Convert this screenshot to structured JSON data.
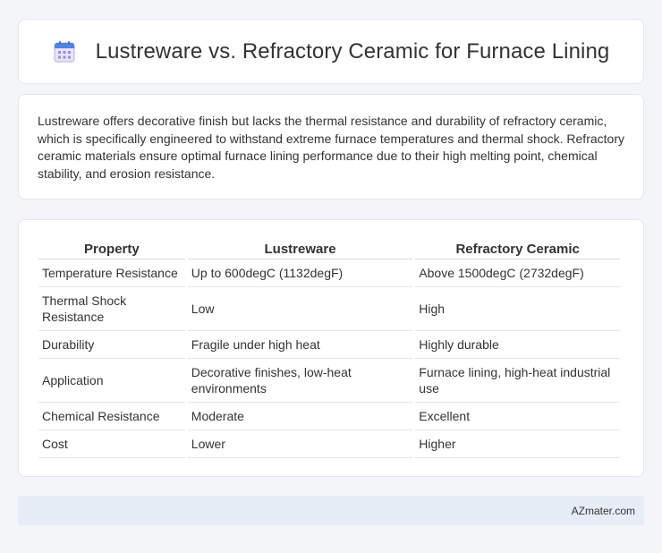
{
  "header": {
    "icon": "calendar-icon",
    "title": "Lustreware vs. Refractory Ceramic for Furnace Lining"
  },
  "summary": {
    "text": "Lustreware offers decorative finish but lacks the thermal resistance and durability of refractory ceramic, which is specifically engineered to withstand extreme furnace temperatures and thermal shock. Refractory ceramic materials ensure optimal furnace lining performance due to their high melting point, chemical stability, and erosion resistance."
  },
  "table": {
    "headers": [
      "Property",
      "Lustreware",
      "Refractory Ceramic"
    ],
    "rows": [
      [
        "Temperature Resistance",
        "Up to 600degC (1132degF)",
        "Above 1500degC (2732degF)"
      ],
      [
        "Thermal Shock Resistance",
        "Low",
        "High"
      ],
      [
        "Durability",
        "Fragile under high heat",
        "Highly durable"
      ],
      [
        "Application",
        "Decorative finishes, low-heat environments",
        "Furnace lining, high-heat industrial use"
      ],
      [
        "Chemical Resistance",
        "Moderate",
        "Excellent"
      ],
      [
        "Cost",
        "Lower",
        "Higher"
      ]
    ]
  },
  "footer": {
    "text": "AZmater.com"
  },
  "colors": {
    "background": "#f3f5f9",
    "card": "#ffffff",
    "footer_bg": "#e7edf7",
    "icon_blue": "#4a86e8",
    "icon_purple": "#9b8ce0"
  }
}
